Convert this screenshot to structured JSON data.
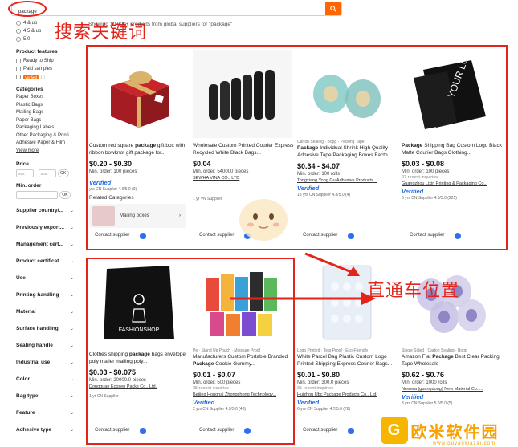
{
  "search": {
    "query": "package",
    "annotation": "搜索关键词"
  },
  "results_summary": "Showing 10,000+ products from global suppliers for \"package\"",
  "sidebar": {
    "ratings": [
      "4 & up",
      "4.5 & up",
      "5.0"
    ],
    "product_features_title": "Product features",
    "features": [
      "Ready to Ship",
      "Paid samples",
      "Verified"
    ],
    "categories_title": "Categories",
    "categories": [
      "Paper Boxes",
      "Plastic Bags",
      "Mailing Bags",
      "Paper Bags",
      "Packaging Labels",
      "Other Packaging & Printi...",
      "Adhesive Paper & Film"
    ],
    "view_more": "View more",
    "price_title": "Price",
    "price_min": "Min.",
    "price_max": "Max.",
    "ok": "OK",
    "min_order_title": "Min. order",
    "filters": [
      "Supplier country/...",
      "Previously export...",
      "Management cert...",
      "Product certificat...",
      "Use",
      "Printing handling",
      "Material",
      "Surface handling",
      "Sealing handle",
      "Industrial use",
      "Color",
      "Bag type",
      "Feature",
      "Adhesive type"
    ]
  },
  "products": [
    {
      "tag": "",
      "title_pre": "Custom red square ",
      "title_bold": "package",
      "title_post": " gift box with ribbon bowknot gift package for...",
      "price": "$0.20 - $0.30",
      "moq": "Min. order: 100 pieces",
      "recent": "",
      "supplier": "",
      "verified": "Verified",
      "meta": "yrs CN Supplier 4.6/5.0 (9)",
      "related_categories": "Related Categories",
      "related_item": "Mailing boxes",
      "contact": "Contact supplier"
    },
    {
      "tag": "",
      "title_pre": "Wholesale Custom Printed Courier Express Recycled White Black Bags...",
      "title_bold": "",
      "title_post": "",
      "price": "$0.04",
      "moq": "Min. order: 540000 pieces",
      "recent": "",
      "supplier": "SEWHA VINA CO., LTD",
      "verified": "",
      "meta": "1 yr VN Supplier",
      "contact": "Contact supplier"
    },
    {
      "tag": "Carton Sealing · Bopp · Packing Tape",
      "title_pre": "",
      "title_bold": "Package",
      "title_post": " Individual Shrink High Quality Adhesive Tape Packaging Boxes Facto...",
      "price": "$0.34 - $4.07",
      "moq": "Min. order: 100 rolls",
      "recent": "",
      "supplier": "Tongxiang Yong Gu Adhesive Products...",
      "verified": "Verified",
      "meta": "13 yrs CN Supplier 4.8/5.0 (4)",
      "contact": "Contact supplier"
    },
    {
      "tag": "",
      "title_pre": "",
      "title_bold": "Package",
      "title_post": " Shipping Bag Custom Logo Black Matte Courier Bags Clothing...",
      "price": "$0.03 - $0.08",
      "moq": "Min. order: 100 pieces",
      "recent": "27 recent inquiries",
      "supplier": "Guangzhou Lixin Printing & Packaging Co...",
      "verified": "Verified",
      "meta": "6 yrs CN Supplier 4.6/5.0 (221)",
      "contact": "Contact supplier",
      "image_text": "YOUR LOGO"
    },
    {
      "tag": "",
      "title_pre": "Clothes shipping ",
      "title_bold": "package",
      "title_post": " bags envelope poly mailer mailing poly...",
      "price": "$0.03 - $0.075",
      "moq": "Min. order: 20000.0 pieces",
      "recent": "",
      "supplier": "Dongguan Ecosen Packs Co., Ltd.",
      "verified": "",
      "meta": "1 yr CN Supplier",
      "contact": "Contact supplier",
      "image_text": "FASHIONSHOP"
    },
    {
      "tag": "Pe · Stand Up Pouch · Moisture Proof",
      "title_pre": "Manufacturers Custom Portable Branded ",
      "title_bold": "Package",
      "title_post": " Cookie Gummy...",
      "price": "$0.01 - $0.07",
      "moq": "Min. order: 500 pieces",
      "recent": "35 recent inquiries",
      "supplier": "Beijing Honghai Zhongchong Technology...",
      "verified": "Verified",
      "meta": "2 yrs CN Supplier 4.9/5.0 (43)",
      "contact": "Contact supplier"
    },
    {
      "tag": "Logo Printed · Tear Proof · Eco-Friendly",
      "title_pre": "White Parcel Bag Plastic Custom Logo Printed Shipping Express Courier Bags...",
      "title_bold": "",
      "title_post": "",
      "price": "$0.01 - $0.80",
      "moq": "Min. order: 300.0 pieces",
      "recent": "35 recent inquiries",
      "supplier": "Huizhou Ubc Package Products Co., Ltd.",
      "verified": "Verified",
      "meta": "6 yrs CN Supplier 4.7/5.0 (78)",
      "contact": "Contact supplier"
    },
    {
      "tag": "Single Sided · Carton Sealing · Bopp",
      "title_pre": "Amazon Flat ",
      "title_bold": "Package",
      "title_post": " Best Clear Packing Tape Wholesale",
      "price": "$0.62 - $0.76",
      "moq": "Min. order: 1000 rolls",
      "recent": "",
      "supplier": "Newera (guangdong) New Material Co.,...",
      "verified": "Verified",
      "meta": "3 yrs CN Supplier 5.0/5.0 (5)",
      "contact": "Contact supplier"
    }
  ],
  "watermark": {
    "text": "欧米软件园",
    "logo": "G",
    "url": "www.ouyaoxiazai.com"
  },
  "colors": {
    "accent": "#ff6600",
    "annotation_red": "#e3241b",
    "verified_blue": "#1d6ae5"
  }
}
